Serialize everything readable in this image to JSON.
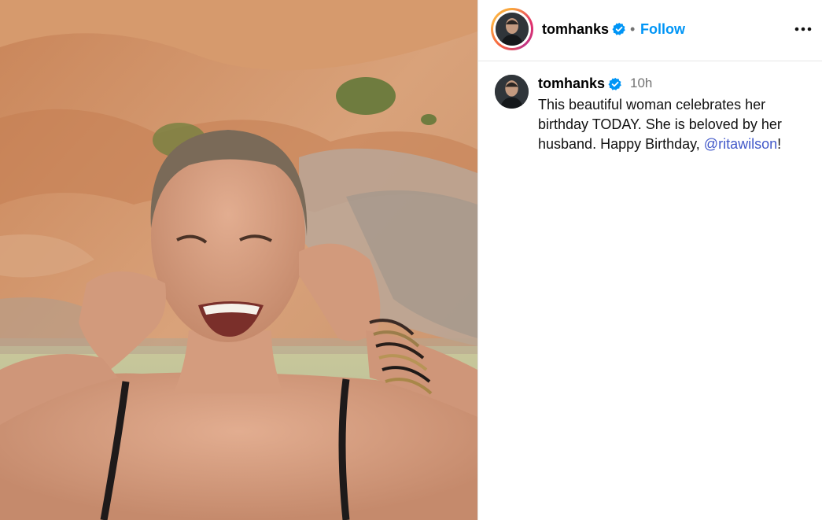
{
  "post": {
    "image_alt": "Smiling woman in a black swimsuit holding her ears in front of orange rocky cliffs by the sea"
  },
  "header": {
    "username": "tomhanks",
    "separator": "•",
    "follow_label": "Follow",
    "more_icon": "more-horizontal-icon"
  },
  "caption": {
    "username": "tomhanks",
    "time": "10h",
    "text_before": "This beautiful woman celebrates her birthday TODAY.  She is beloved by her husband. Happy Birthday, ",
    "mention": "@ritawilson",
    "text_after": "!"
  },
  "colors": {
    "follow": "#0095f6",
    "mention": "#4259c9",
    "verified": "#0095f6",
    "muted": "#737373"
  }
}
